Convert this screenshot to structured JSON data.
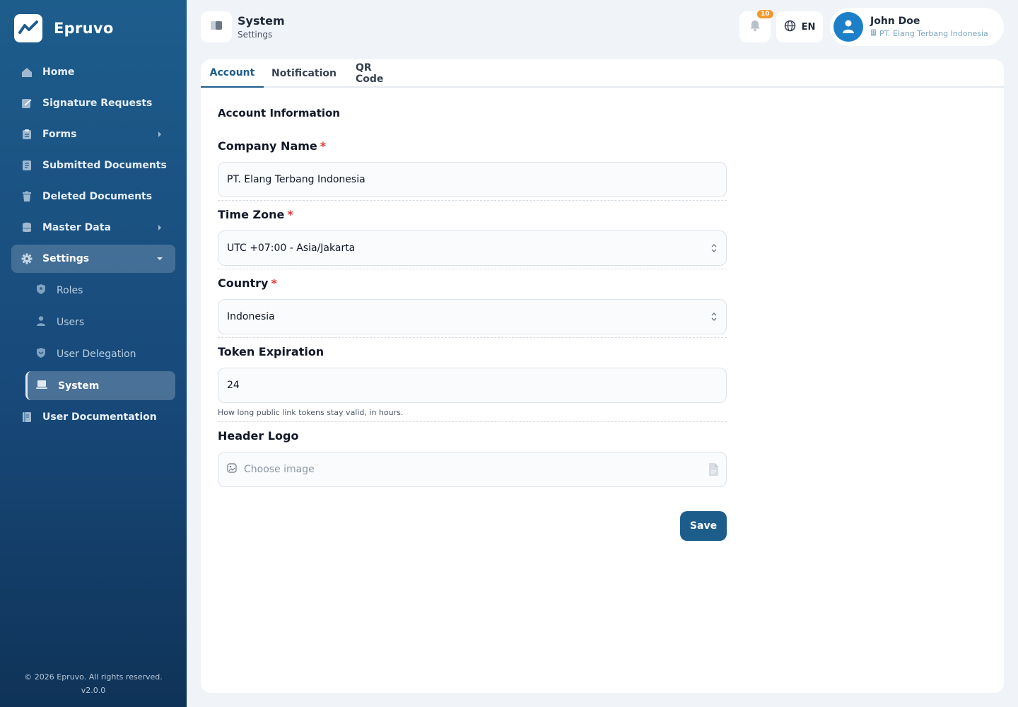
{
  "brand": {
    "name": "Epruvo"
  },
  "sidebar": {
    "items": [
      {
        "label": "Home"
      },
      {
        "label": "Signature Requests"
      },
      {
        "label": "Forms"
      },
      {
        "label": "Submitted Documents"
      },
      {
        "label": "Deleted Documents"
      },
      {
        "label": "Master Data"
      },
      {
        "label": "Settings"
      }
    ],
    "settings_sub": [
      {
        "label": "Roles"
      },
      {
        "label": "Users"
      },
      {
        "label": "User Delegation"
      },
      {
        "label": "System"
      }
    ],
    "after": [
      {
        "label": "User Documentation"
      }
    ],
    "footer_copyright": "© 2026 Epruvo. All rights reserved.",
    "footer_version": "v2.0.0"
  },
  "header": {
    "title": "System",
    "subtitle": "Settings",
    "notification_count": "10",
    "language": "EN",
    "user_name": "John Doe",
    "user_company": "PT. Elang Terbang Indonesia"
  },
  "tabs": [
    {
      "label": "Account"
    },
    {
      "label": "Notification"
    },
    {
      "label": "QR Code"
    }
  ],
  "form": {
    "section_title": "Account Information",
    "company_name": {
      "label": "Company Name",
      "value": "PT. Elang Terbang Indonesia"
    },
    "time_zone": {
      "label": "Time Zone",
      "value": "UTC +07:00 - Asia/Jakarta"
    },
    "country": {
      "label": "Country",
      "value": "Indonesia"
    },
    "token_expiration": {
      "label": "Token Expiration",
      "value": "24",
      "hint": "How long public link tokens stay valid, in hours."
    },
    "header_logo": {
      "label": "Header Logo",
      "placeholder": "Choose image"
    },
    "required_mark": "*",
    "save_label": "Save"
  },
  "colors": {
    "primary": "#1d5d8c",
    "badge": "#f29a2e",
    "required": "#e53935",
    "avatar": "#1c7fc7"
  }
}
